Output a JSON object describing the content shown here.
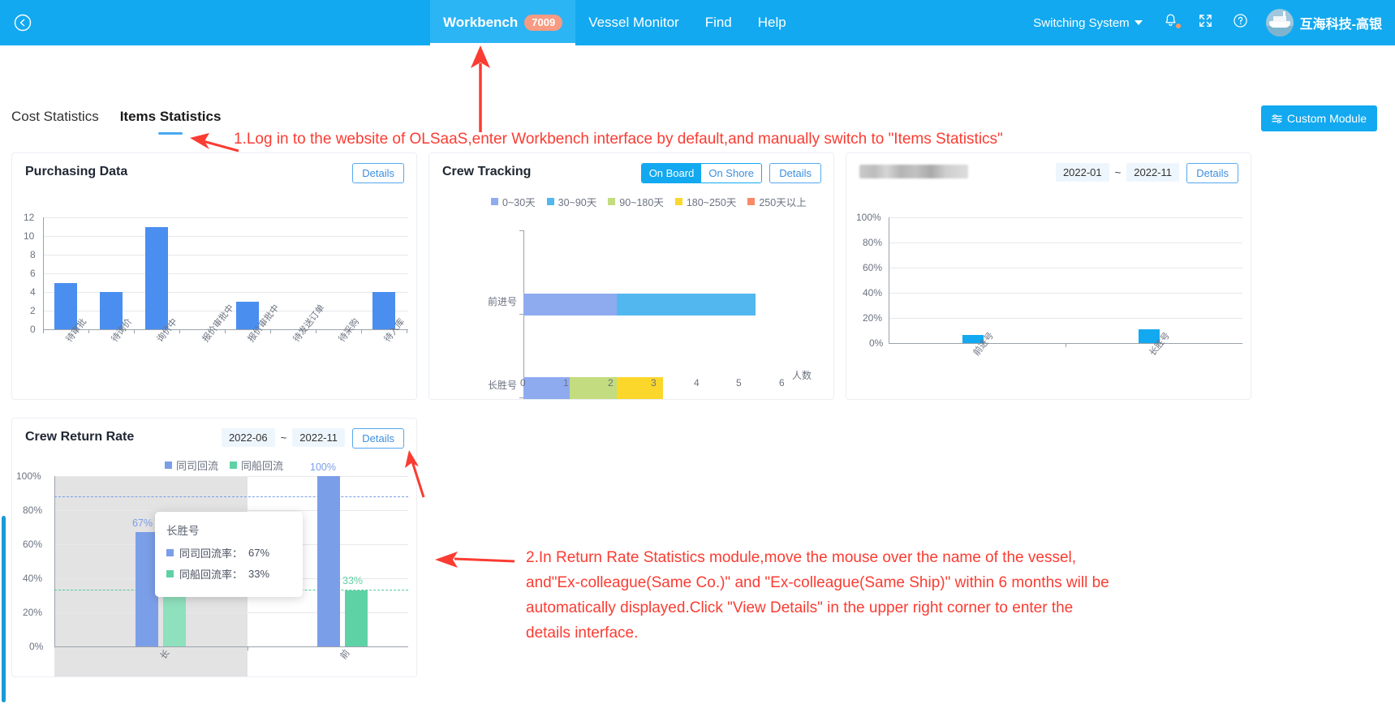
{
  "header": {
    "back_icon": "back-circle-icon",
    "nav": [
      {
        "label": "Workbench",
        "badge": "7009",
        "active": true
      },
      {
        "label": "Vessel Monitor",
        "badge": "",
        "active": false
      },
      {
        "label": "Find",
        "badge": "",
        "active": false
      },
      {
        "label": "Help",
        "badge": "",
        "active": false
      }
    ],
    "switch_system": "Switching System",
    "bell_icon": "bell-icon",
    "fullscreen_icon": "fullscreen-icon",
    "help_icon": "question-circle-icon",
    "avatar_icon": "vessel-avatar",
    "company": "互海科技-高银"
  },
  "tabs": [
    {
      "label": "Cost Statistics",
      "active": false
    },
    {
      "label": "Items Statistics",
      "active": true
    }
  ],
  "custom_module": {
    "label": "Custom Module",
    "icon": "sliders-icon"
  },
  "cards": {
    "purchasing": {
      "title": "Purchasing Data",
      "details_label": "Details"
    },
    "crew_tracking": {
      "title": "Crew Tracking",
      "segment": [
        {
          "label": "On Board",
          "selected": true
        },
        {
          "label": "On Shore",
          "selected": false
        }
      ],
      "details_label": "Details"
    },
    "redacted": {
      "title": "",
      "date_from": "2022-01",
      "date_sep": "~",
      "date_to": "2022-11",
      "details_label": "Details"
    },
    "crew_return": {
      "title": "Crew Return Rate",
      "date_from": "2022-06",
      "date_sep": "~",
      "date_to": "2022-11",
      "details_label": "Details",
      "tooltip": {
        "vessel": "长胜号",
        "rows": [
          {
            "label": "同司回流率：",
            "value": "67%",
            "color": "#7b9ee8"
          },
          {
            "label": "同船回流率：",
            "value": "33%",
            "color": "#5fd2a5"
          }
        ]
      }
    }
  },
  "annotations": [
    {
      "id": "anno-1",
      "text": "1.Log in to the website of OLSaaS,enter Workbench interface by default,and manually switch to \"Items Statistics\""
    },
    {
      "id": "anno-2",
      "text": "2.In Return Rate Statistics module,move the mouse over the name of the vessel,\nand\"Ex-colleague(Same Co.)\" and \"Ex-colleague(Same Ship)\" within 6 months will be\nautomatically displayed.Click \"View Details\" in the upper right corner to enter the\ndetails interface."
    }
  ],
  "colors": {
    "brand_blue": "#12a9f0",
    "bar_blue": "#4a8ef0",
    "annotation_red": "#fa3c32",
    "series_0_30": "#8fabf0",
    "series_30_90": "#53b7ef",
    "series_90_180": "#c2dc7f",
    "series_180_250": "#fbd72b",
    "series_250_plus": "#f98a68",
    "return_same_co": "#7b9ee8",
    "return_same_ship": "#5fd2a5"
  },
  "chart_data": [
    {
      "id": "purchasing-data-chart",
      "type": "bar",
      "title": "Purchasing Data",
      "categories": [
        "待审批",
        "待询价",
        "询价中",
        "报价审批中",
        "报价审批中",
        "待发送订单",
        "待采购",
        "待入库"
      ],
      "values": [
        5,
        4,
        11,
        0,
        3,
        0,
        0,
        4
      ],
      "ylim": [
        0,
        12
      ],
      "yticks": [
        0,
        2,
        4,
        6,
        8,
        10,
        12
      ],
      "xlabel": "",
      "ylabel": "",
      "grid": true,
      "legend": "none"
    },
    {
      "id": "crew-tracking-chart",
      "type": "bar",
      "orientation": "horizontal",
      "stacked": true,
      "title": "Crew Tracking",
      "categories": [
        "前进号",
        "长胜号"
      ],
      "series": [
        {
          "name": "0~30天",
          "color": "#8fabf0",
          "values": [
            2,
            1
          ]
        },
        {
          "name": "30~90天",
          "color": "#53b7ef",
          "values": [
            3,
            0
          ]
        },
        {
          "name": "90~180天",
          "color": "#c2dc7f",
          "values": [
            0,
            1
          ]
        },
        {
          "name": "180~250天",
          "color": "#fbd72b",
          "values": [
            0,
            1
          ]
        },
        {
          "name": "250天以上",
          "color": "#f98a68",
          "values": [
            0,
            0
          ]
        }
      ],
      "xlim": [
        0,
        6
      ],
      "xticks": [
        0,
        1,
        2,
        3,
        4,
        5,
        6
      ],
      "xlabel": "人数",
      "ylabel": "",
      "legend": "top"
    },
    {
      "id": "redacted-chart",
      "type": "bar",
      "title": "",
      "categories": [
        "前进号",
        "长胜号"
      ],
      "values": [
        6,
        11
      ],
      "ylim": [
        0,
        100
      ],
      "yticks": [
        "0%",
        "20%",
        "40%",
        "60%",
        "80%",
        "100%"
      ],
      "xlabel": "",
      "ylabel": "",
      "grid": true,
      "legend": "none"
    },
    {
      "id": "crew-return-rate-chart",
      "type": "bar",
      "title": "Crew Return Rate",
      "categories": [
        "长胜号",
        "前进号"
      ],
      "series": [
        {
          "name": "同司回流",
          "color": "#7b9ee8",
          "values": [
            67,
            100
          ]
        },
        {
          "name": "同船回流",
          "color": "#5fd2a5",
          "values": [
            33,
            33
          ]
        }
      ],
      "value_labels": [
        "67%",
        "100%",
        "33%"
      ],
      "ylim": [
        0,
        100
      ],
      "yticks": [
        "0%",
        "20%",
        "40%",
        "60%",
        "80%",
        "100%"
      ],
      "average_lines": [
        {
          "name": "同司回流",
          "value": 88,
          "color": "#7a9fe8"
        },
        {
          "name": "同船回流",
          "value": 33,
          "color": "#4ecb9a"
        }
      ],
      "xlabel": "",
      "ylabel": "",
      "grid": true,
      "legend": "top"
    }
  ]
}
